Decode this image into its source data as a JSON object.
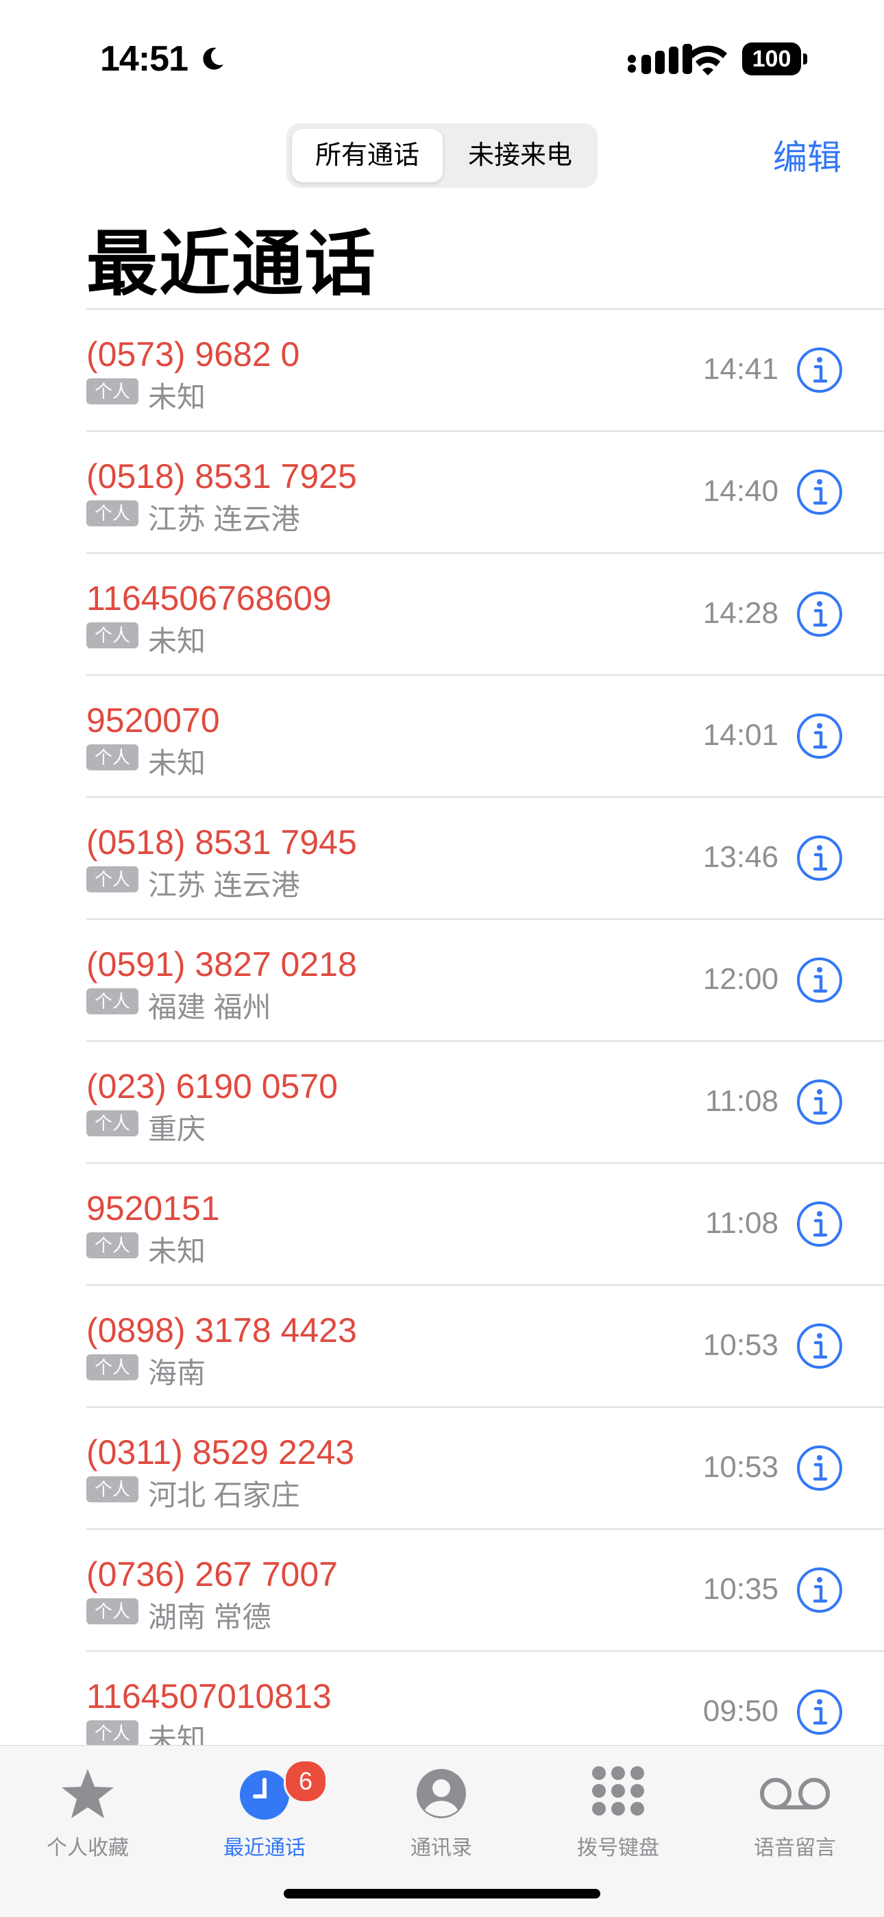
{
  "status_bar": {
    "time": "14:51",
    "battery": "100"
  },
  "segment": {
    "all_label": "所有通话",
    "missed_label": "未接来电",
    "selected": "所有通话"
  },
  "header": {
    "edit_label": "编辑",
    "title": "最近通话"
  },
  "calls": [
    {
      "number": "(0573) 9682 0",
      "tag": "个人",
      "location": "未知",
      "time": "14:41"
    },
    {
      "number": "(0518) 8531 7925",
      "tag": "个人",
      "location": "江苏 连云港",
      "time": "14:40"
    },
    {
      "number": "1164506768609",
      "tag": "个人",
      "location": "未知",
      "time": "14:28"
    },
    {
      "number": "9520070",
      "tag": "个人",
      "location": "未知",
      "time": "14:01"
    },
    {
      "number": "(0518) 8531 7945",
      "tag": "个人",
      "location": "江苏 连云港",
      "time": "13:46"
    },
    {
      "number": "(0591) 3827 0218",
      "tag": "个人",
      "location": "福建 福州",
      "time": "12:00"
    },
    {
      "number": "(023) 6190 0570",
      "tag": "个人",
      "location": "重庆",
      "time": "11:08"
    },
    {
      "number": "9520151",
      "tag": "个人",
      "location": "未知",
      "time": "11:08"
    },
    {
      "number": "(0898) 3178 4423",
      "tag": "个人",
      "location": "海南",
      "time": "10:53"
    },
    {
      "number": "(0311) 8529 2243",
      "tag": "个人",
      "location": "河北 石家庄",
      "time": "10:53"
    },
    {
      "number": "(0736) 267 7007",
      "tag": "个人",
      "location": "湖南 常德",
      "time": "10:35"
    },
    {
      "number": "1164507010813",
      "tag": "个人",
      "location": "未知",
      "time": "09:50"
    }
  ],
  "tabbar": {
    "favorites": {
      "label": "个人收藏",
      "icon": "star-icon"
    },
    "recents": {
      "label": "最近通话",
      "icon": "clock-icon",
      "badge": "6"
    },
    "contacts": {
      "label": "通讯录",
      "icon": "person-icon"
    },
    "keypad": {
      "label": "拨号键盘",
      "icon": "keypad-icon"
    },
    "voicemail": {
      "label": "语音留言",
      "icon": "voicemail-icon"
    }
  },
  "colors": {
    "accent": "#3478f6",
    "missed": "#e04a3f",
    "badge": "#eb4d3d",
    "secondary": "#8e8e93"
  }
}
